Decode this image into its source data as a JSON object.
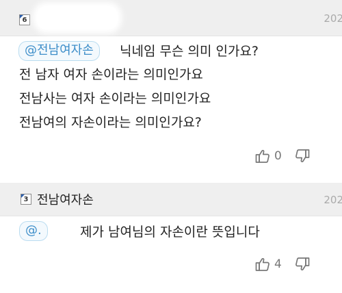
{
  "comments": [
    {
      "level": "6",
      "date": "202",
      "mention": "@전남여자손",
      "lines": [
        "닉네임 무슨 의미 인가요?",
        "전 남자 여자 손이라는 의미인가요",
        "전남사는 여자 손이라는 의미인가요",
        "전남여의 자손이라는 의미인가요?"
      ],
      "like_count": "0",
      "like_icon": "thumbs-up-icon",
      "dislike_icon": "thumbs-down-icon"
    },
    {
      "level": "3",
      "nickname": "전남여자손",
      "date": "202",
      "mention": "@.",
      "lines": [
        "제가 남여님의 자손이란 뜻입니다"
      ],
      "like_count": "4",
      "like_icon": "thumbs-up-icon",
      "dislike_icon": "thumbs-down-icon"
    }
  ],
  "colors": {
    "header_bg": "#efefef",
    "mention_text": "#3d8ec9",
    "mention_border": "#b9dcf0",
    "date_text": "#aaaaaa",
    "icon_gray": "#777777",
    "badge_accent": "#2a5fb0"
  }
}
